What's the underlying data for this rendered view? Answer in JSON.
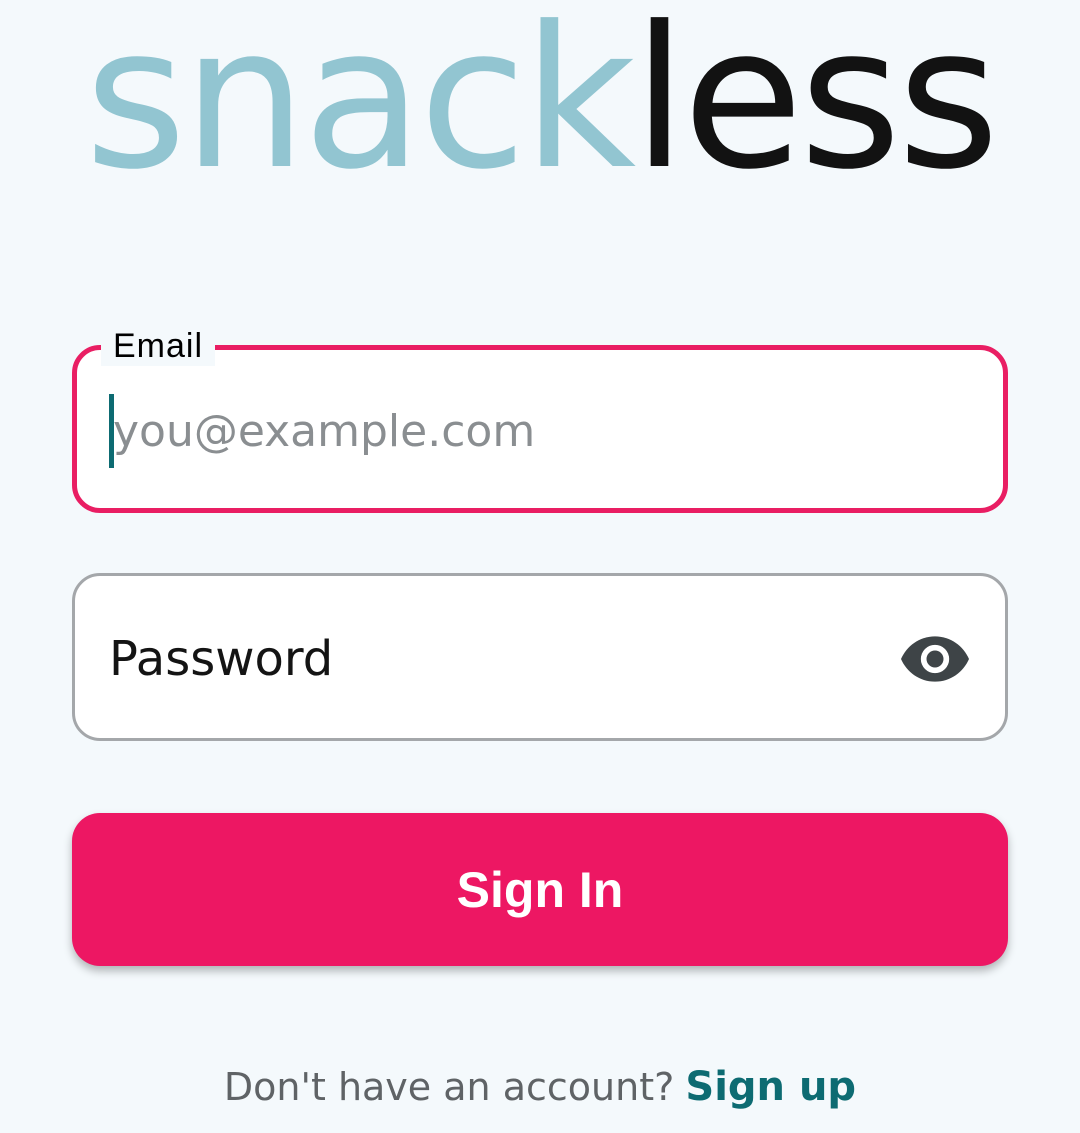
{
  "theme": {
    "background": "#f4f9fc",
    "accent": "#ed1763",
    "focus_border": "#e91e63",
    "link": "#0d6b72",
    "logo_light": "#92c5d1",
    "logo_dark": "#121212"
  },
  "logo": {
    "part1": "snack",
    "part2": "less"
  },
  "email": {
    "label": "Email",
    "placeholder": "you@example.com",
    "value": ""
  },
  "password": {
    "placeholder": "Password",
    "value": "",
    "visibility_icon": "eye-icon"
  },
  "signin": {
    "label": "Sign In"
  },
  "signup": {
    "prompt": "Don't have an account?",
    "link_label": "Sign up"
  }
}
